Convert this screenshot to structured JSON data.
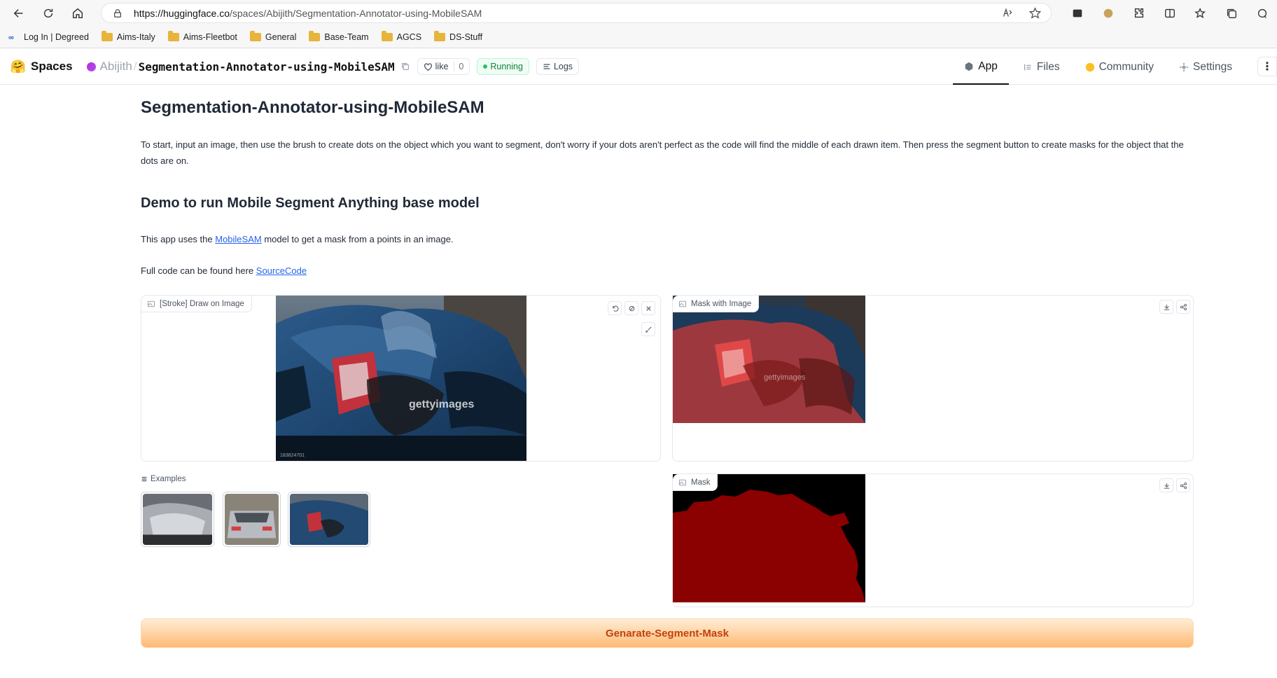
{
  "browser": {
    "url_host": "https://huggingface.co",
    "url_path": "/spaces/Abijith/Segmentation-Annotator-using-MobileSAM",
    "bookmarks": [
      "Log In | Degreed",
      "Aims-Italy",
      "Aims-Fleetbot",
      "General",
      "Base-Team",
      "AGCS",
      "DS-Stuff"
    ]
  },
  "header": {
    "spaces": "Spaces",
    "owner": "Abijith",
    "repo": "Segmentation-Annotator-using-MobileSAM",
    "like": "like",
    "like_count": "0",
    "status": "Running",
    "logs": "Logs",
    "tabs": [
      "App",
      "Files",
      "Community",
      "Settings"
    ]
  },
  "main": {
    "title": "Segmentation-Annotator-using-MobileSAM",
    "description": "To start, input an image, then use the brush to create dots on the object which you want to segment, don't worry if your dots aren't perfect as the code will find the middle of each drawn item. Then press the segment button to create masks for the object that the dots are on.",
    "subtitle": "Demo to run Mobile Segment Anything base model",
    "p1_pre": "This app uses the ",
    "p1_link": "MobileSAM",
    "p1_post": " model to get a mask from a points in an image.",
    "p2_pre": "Full code can be found here ",
    "p2_link": "SourceCode",
    "draw_label": "[Stroke] Draw on Image",
    "mask_image_label": "Mask with Image",
    "mask_label": "Mask",
    "examples_label": "Examples",
    "button": "Genarate-Segment-Mask",
    "watermark": "gettyimages",
    "image_id": "183824701"
  },
  "colors": {
    "accent": "#c2410c",
    "mask_red": "#8b0000",
    "running": "#15803d"
  }
}
